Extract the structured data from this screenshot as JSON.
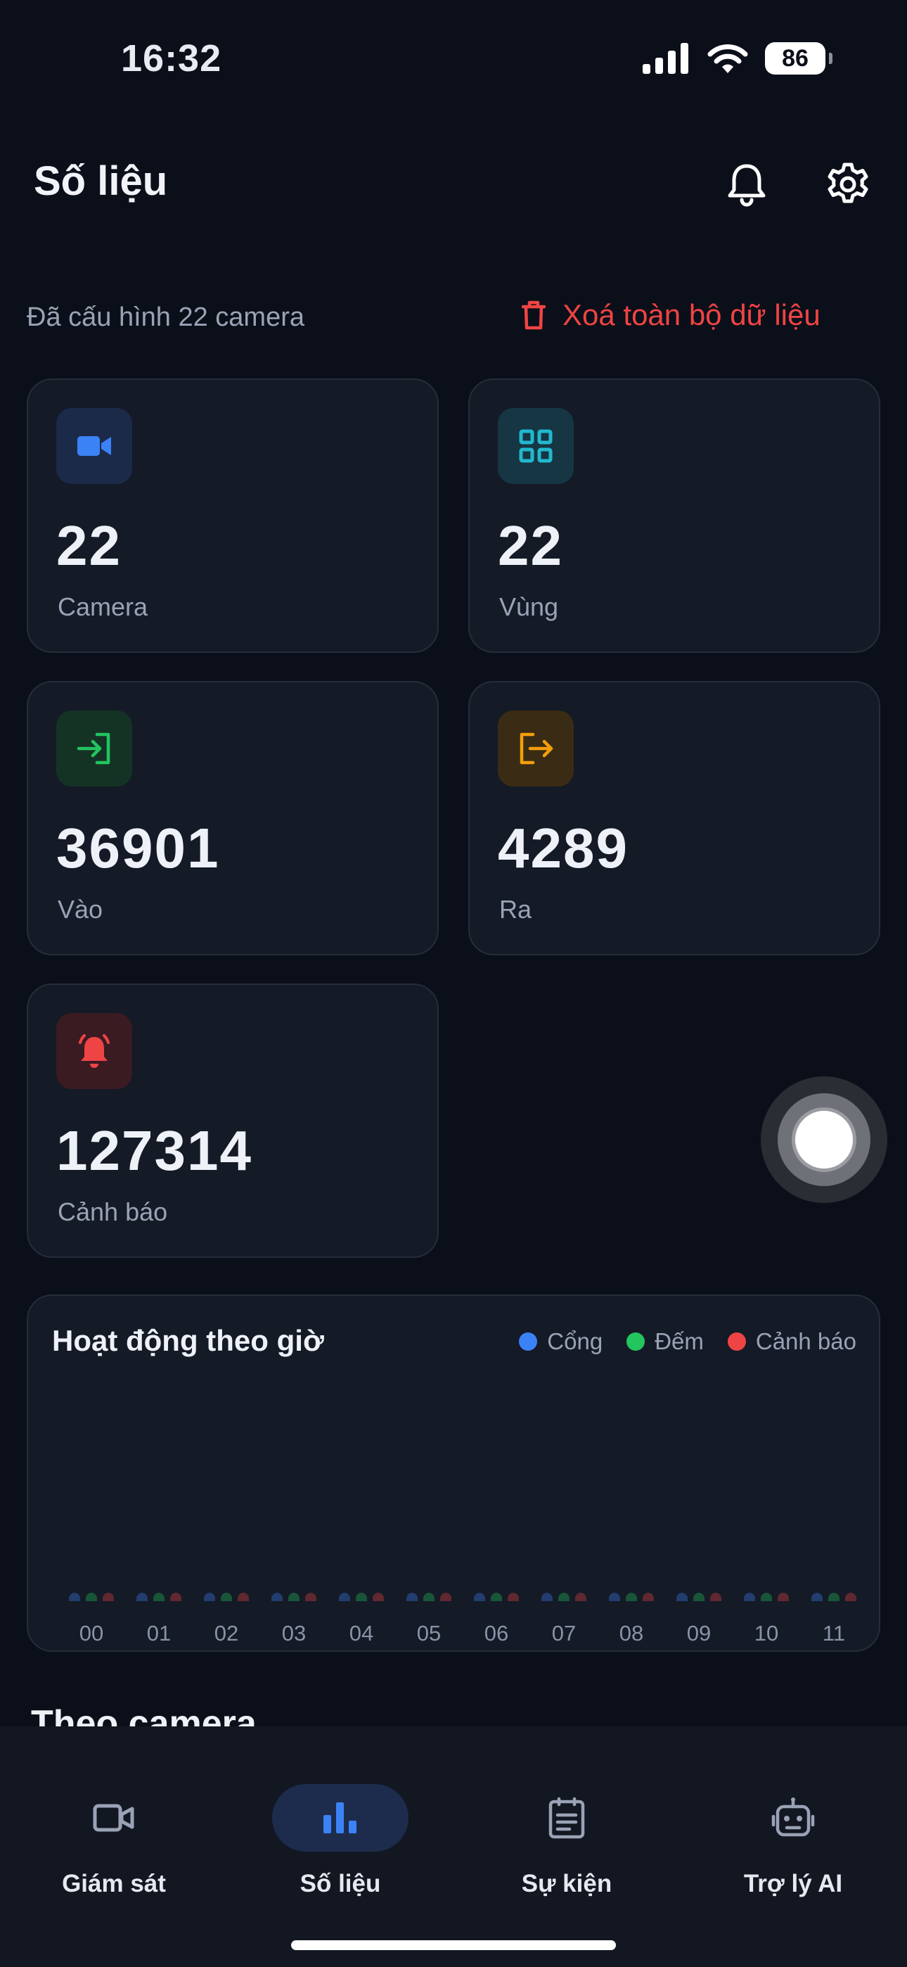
{
  "status_bar": {
    "time": "16:32",
    "battery": "86"
  },
  "header": {
    "title": "Số liệu"
  },
  "summary": {
    "info": "Đã cấu hình 22 camera",
    "delete_label": "Xoá toàn bộ dữ liệu"
  },
  "stats": [
    {
      "value": "22",
      "label": "Camera",
      "icon": "video-camera-icon",
      "color": "#3b82f6",
      "bg": "#1c2a4a"
    },
    {
      "value": "22",
      "label": "Vùng",
      "icon": "grid-icon",
      "color": "#22b8cf",
      "bg": "#153642"
    },
    {
      "value": "36901",
      "label": "Vào",
      "icon": "login-icon",
      "color": "#22c55e",
      "bg": "#143325"
    },
    {
      "value": "4289",
      "label": "Ra",
      "icon": "logout-icon",
      "color": "#f59e0b",
      "bg": "#3a2c14"
    },
    {
      "value": "127314",
      "label": "Cảnh báo",
      "icon": "alarm-bell-icon",
      "color": "#ef4444",
      "bg": "#3a1b22"
    }
  ],
  "hourly_chart": {
    "title": "Hoạt động theo giờ",
    "legend": [
      {
        "name": "Cổng",
        "color": "#3b82f6"
      },
      {
        "name": "Đếm",
        "color": "#22c55e"
      },
      {
        "name": "Cảnh báo",
        "color": "#ef4444"
      }
    ]
  },
  "chart_data": {
    "type": "bar",
    "title": "Hoạt động theo giờ",
    "categories": [
      "00",
      "01",
      "02",
      "03",
      "04",
      "05",
      "06",
      "07",
      "08",
      "09",
      "10",
      "11"
    ],
    "series": [
      {
        "name": "Cổng",
        "values": [
          0,
          0,
          0,
          0,
          0,
          0,
          0,
          0,
          0,
          0,
          0,
          0
        ]
      },
      {
        "name": "Đếm",
        "values": [
          0,
          0,
          0,
          0,
          0,
          0,
          0,
          0,
          0,
          0,
          0,
          0
        ]
      },
      {
        "name": "Cảnh báo",
        "values": [
          0,
          0,
          0,
          0,
          0,
          0,
          0,
          0,
          0,
          0,
          0,
          0
        ]
      }
    ],
    "legend_position": "top-right",
    "grid": false
  },
  "section_peek": "Theo camera",
  "nav": {
    "items": [
      {
        "label": "Giám sát",
        "icon": "video-camera-icon",
        "active": false
      },
      {
        "label": "Số liệu",
        "icon": "bar-chart-icon",
        "active": true
      },
      {
        "label": "Sự kiện",
        "icon": "event-list-icon",
        "active": false
      },
      {
        "label": "Trợ lý AI",
        "icon": "robot-icon",
        "active": false
      }
    ],
    "active_color": "#3b82f6",
    "active_bg": "#1d2c4c",
    "inactive_color": "#9aa3b5"
  }
}
